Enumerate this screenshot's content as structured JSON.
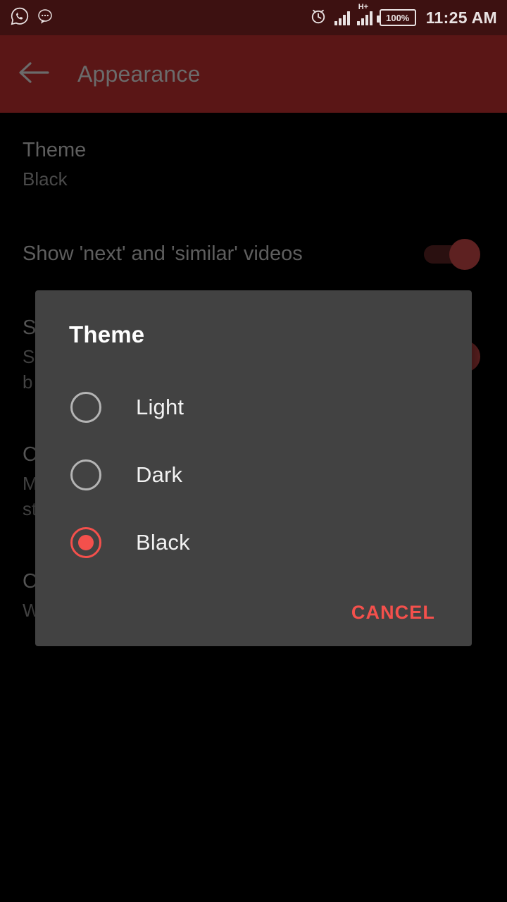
{
  "status_bar": {
    "left_icons": [
      "whatsapp-icon",
      "message-bubble-icon"
    ],
    "alarm_icon": "alarm-clock-icon",
    "network_type": "H+",
    "battery_level": "100%",
    "time": "11:25 AM"
  },
  "app_bar": {
    "back_icon": "back-arrow-icon",
    "title": "Appearance"
  },
  "settings": {
    "items": [
      {
        "title": "Theme",
        "subtitle": "Black",
        "has_toggle": false
      },
      {
        "title": "Show 'next' and 'similar' videos",
        "subtitle": "",
        "has_toggle": true
      },
      {
        "title": "S",
        "subtitle": "S",
        "subtitle2": "b",
        "has_toggle": true
      },
      {
        "title": "C",
        "subtitle": "M",
        "subtitle2": "st",
        "has_toggle": false
      },
      {
        "title": "C",
        "subtitle": "W",
        "subtitle2": "",
        "has_toggle": false
      }
    ]
  },
  "dialog": {
    "title": "Theme",
    "options": [
      {
        "label": "Light",
        "selected": false
      },
      {
        "label": "Dark",
        "selected": false
      },
      {
        "label": "Black",
        "selected": true
      }
    ],
    "cancel_label": "CANCEL"
  },
  "colors": {
    "accent_red": "#f4504c",
    "app_bar": "#5a1616",
    "status_bar": "#3d1111",
    "dialog_bg": "#424242",
    "background": "#000000"
  }
}
